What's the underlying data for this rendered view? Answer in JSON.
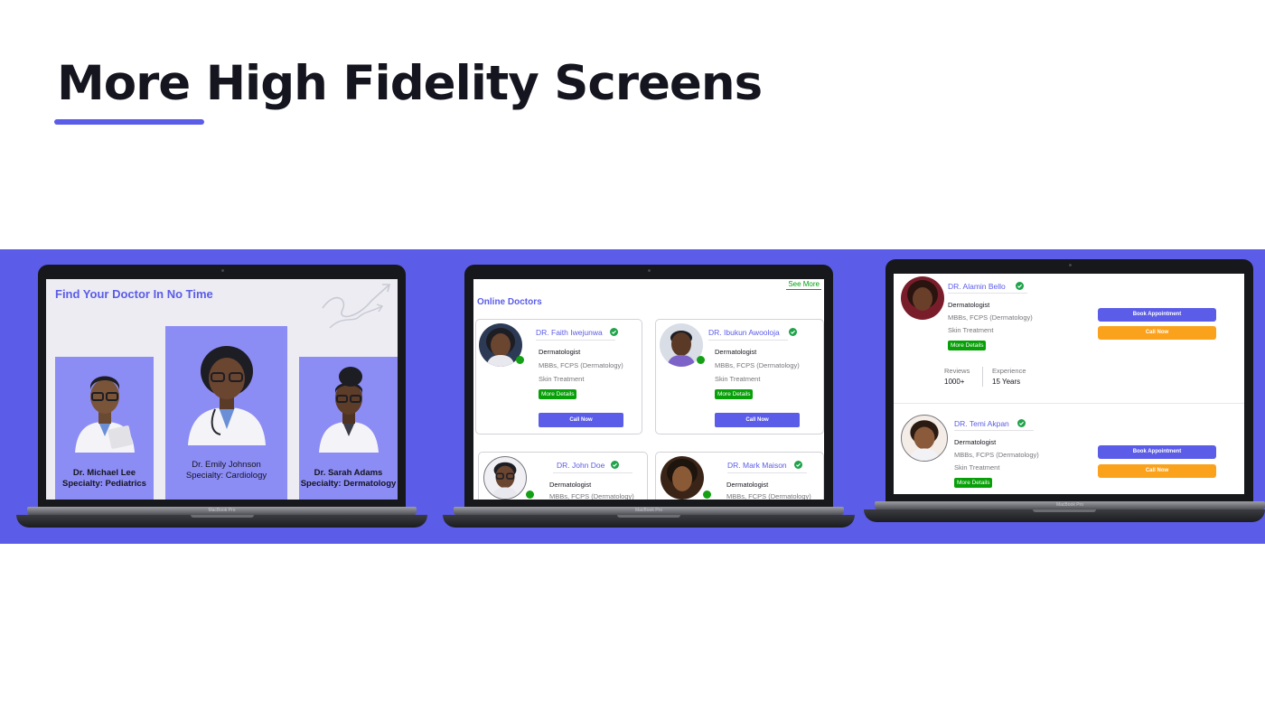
{
  "slide": {
    "title": "More High Fidelity Screens",
    "accent_color": "#5b5ce8",
    "band_color": "#5b5ce8"
  },
  "laptop_label": "MacBook Pro",
  "screen1": {
    "heading": "Find Your Doctor In No Time",
    "doctors": [
      {
        "name": "Dr. Michael Lee",
        "specialty": "Specialty: Pediatrics"
      },
      {
        "name": "Dr. Emily Johnson",
        "specialty": "Specialty: Cardiology"
      },
      {
        "name": "Dr. Sarah Adams",
        "specialty": "Specialty: Dermatology"
      }
    ]
  },
  "screen2": {
    "see_more": "See More",
    "section_title": "Online Doctors",
    "doctors": [
      {
        "name": "DR. Faith Iwejunwa",
        "specialty": "Dermatologist",
        "qualification": "MBBs, FCPS (Dermatology)",
        "treatment": "Skin Treatment",
        "more_label": "More Details",
        "call_label": "Call Now",
        "online": true
      },
      {
        "name": "DR. Ibukun Awooloja",
        "specialty": "Dermatologist",
        "qualification": "MBBs, FCPS (Dermatology)",
        "treatment": "Skin Treatment",
        "more_label": "More Details",
        "call_label": "Call Now",
        "online": true
      },
      {
        "name": "DR. John Doe",
        "specialty": "Dermatologist",
        "qualification": "MBBs, FCPS (Dermatology)",
        "online": true
      },
      {
        "name": "DR. Mark Maison",
        "specialty": "Dermatologist",
        "qualification": "MBBs, FCPS (Dermatology)",
        "online": true
      }
    ]
  },
  "screen3": {
    "doctors": [
      {
        "name": "DR. Alamin Bello",
        "specialty": "Dermatologist",
        "qualification": "MBBs, FCPS (Dermatology)",
        "treatment": "Skin Treatment",
        "more_label": "More Details",
        "book_label": "Book Appointment",
        "call_label": "Call Now",
        "reviews_label": "Reviews",
        "reviews_value": "1000+",
        "experience_label": "Experience",
        "experience_value": "15 Years"
      },
      {
        "name": "DR. Temi Akpan",
        "specialty": "Dermatologist",
        "qualification": "MBBs, FCPS (Dermatology)",
        "treatment": "Skin Treatment",
        "more_label": "More Details",
        "book_label": "Book Appointment",
        "call_label": "Call Now"
      }
    ]
  },
  "colors": {
    "primary": "#5b5ce8",
    "card_purple": "#8c8cf5",
    "success_green": "#08a008",
    "online_green": "#14a014",
    "call_orange": "#fba21c"
  }
}
